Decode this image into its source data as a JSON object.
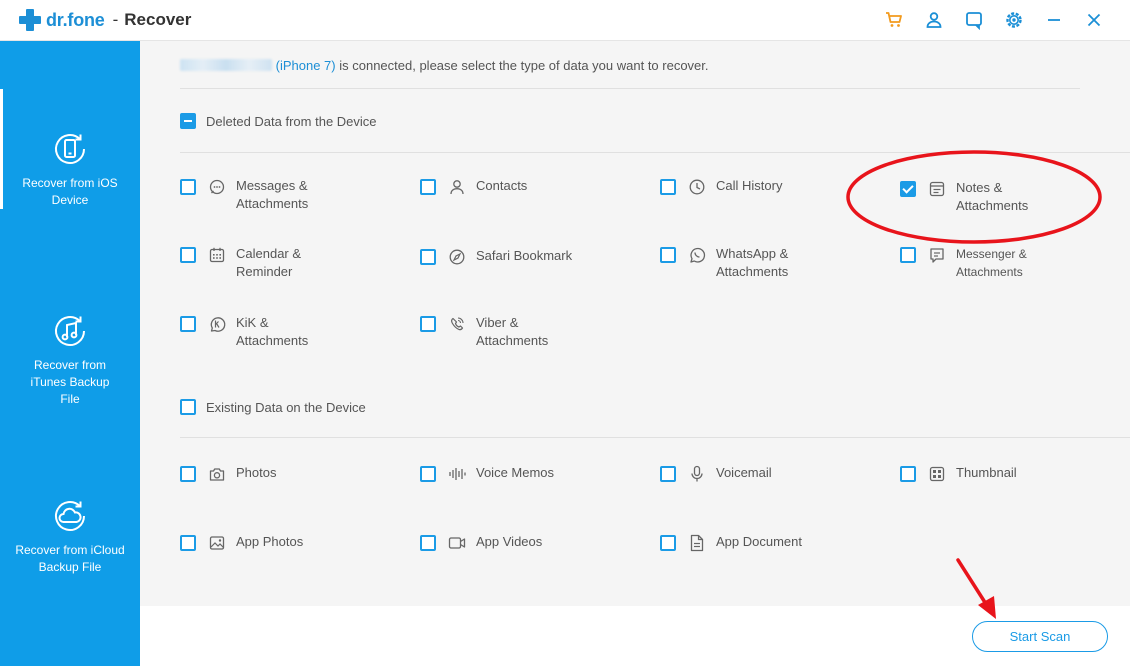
{
  "window": {
    "brand": "dr.fone",
    "separator": "-",
    "title": "Recover"
  },
  "toolbar_icons": [
    "cart-icon",
    "user-icon",
    "feedback-icon",
    "settings-icon",
    "minimize-icon",
    "close-icon"
  ],
  "sidebar": {
    "items": [
      {
        "label": "Recover from iOS Device",
        "icon": "ios-device-icon",
        "active": true
      },
      {
        "label": "Recover from iTunes Backup File",
        "icon": "itunes-icon",
        "active": false
      },
      {
        "label": "Recover from iCloud Backup File",
        "icon": "icloud-icon",
        "active": false
      }
    ]
  },
  "main": {
    "connected_device": "(iPhone 7)",
    "connected_text": "is connected, please select the type of data you want to recover.",
    "deleted_section": {
      "label": "Deleted Data from the Device",
      "state": "partial",
      "items": [
        {
          "line1": "Messages &",
          "line2": "Attachments",
          "icon": "messages-icon",
          "checked": false
        },
        {
          "line1": "Contacts",
          "line2": "",
          "icon": "contacts-icon",
          "checked": false
        },
        {
          "line1": "Call History",
          "line2": "",
          "icon": "call-history-icon",
          "checked": false
        },
        {
          "line1": "Notes &",
          "line2": "Attachments",
          "icon": "notes-icon",
          "checked": true
        },
        {
          "line1": "Calendar &",
          "line2": "Reminder",
          "icon": "calendar-icon",
          "checked": false
        },
        {
          "line1": "Safari Bookmark",
          "line2": "",
          "icon": "safari-icon",
          "checked": false
        },
        {
          "line1": "WhatsApp &",
          "line2": "Attachments",
          "icon": "whatsapp-icon",
          "checked": false
        },
        {
          "line1": "Messenger &",
          "line2": "Attachments",
          "icon": "messenger-icon",
          "checked": false
        },
        {
          "line1": "KiK &",
          "line2": "Attachments",
          "icon": "kik-icon",
          "checked": false
        },
        {
          "line1": "Viber &",
          "line2": "Attachments",
          "icon": "viber-icon",
          "checked": false
        }
      ]
    },
    "existing_section": {
      "label": "Existing Data on the Device",
      "state": "unchecked",
      "items": [
        {
          "line1": "Photos",
          "icon": "photos-icon",
          "checked": false
        },
        {
          "line1": "Voice Memos",
          "icon": "voice-memos-icon",
          "checked": false
        },
        {
          "line1": "Voicemail",
          "icon": "voicemail-icon",
          "checked": false
        },
        {
          "line1": "Thumbnail",
          "icon": "thumbnail-icon",
          "checked": false
        },
        {
          "line1": "App Photos",
          "icon": "app-photos-icon",
          "checked": false
        },
        {
          "line1": "App Videos",
          "icon": "app-videos-icon",
          "checked": false
        },
        {
          "line1": "App Document",
          "icon": "app-document-icon",
          "checked": false
        }
      ]
    }
  },
  "footer": {
    "start_scan_label": "Start Scan"
  },
  "colors": {
    "accent": "#1b9be6",
    "sidebar": "#0f9de8",
    "annotation": "#e8141b"
  }
}
